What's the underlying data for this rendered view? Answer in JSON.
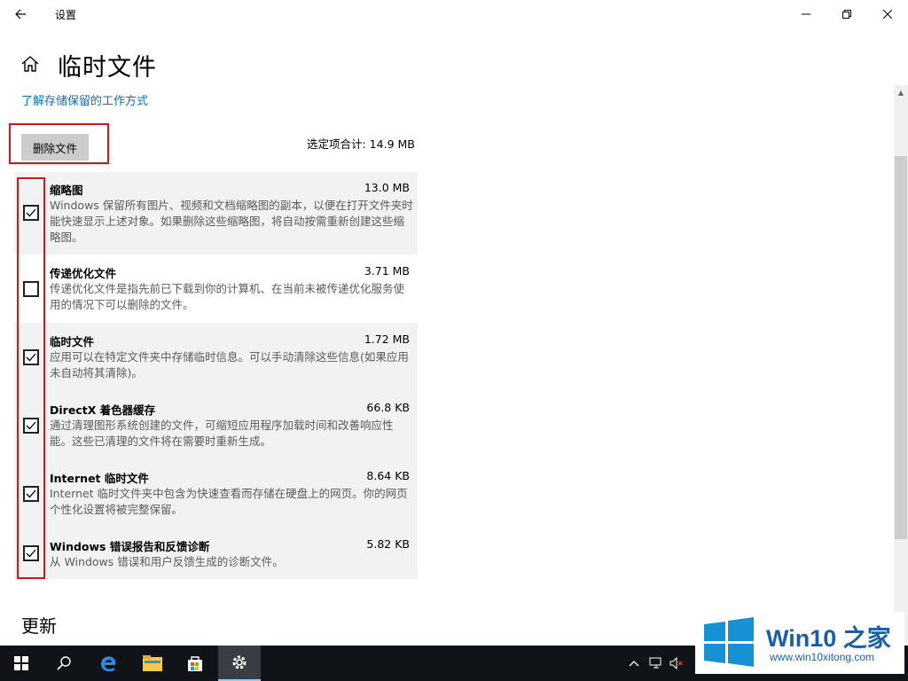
{
  "window": {
    "title": "设置",
    "back_icon": "back-arrow-icon",
    "minimize_icon": "minimize-icon",
    "maximize_icon": "restore-icon",
    "close_icon": "close-icon"
  },
  "header": {
    "home_icon": "home-icon",
    "title": "临时文件",
    "learn_link": "了解存储保留的工作方式"
  },
  "actions": {
    "delete_label": "删除文件",
    "selected_total": "选定项合计: 14.9 MB"
  },
  "items": [
    {
      "name": "缩略图",
      "size": "13.0 MB",
      "checked": true,
      "description": "Windows 保留所有图片、视频和文档缩略图的副本，以便在打开文件夹时能快速显示上述对象。如果删除这些缩略图，将自动按需重新创建这些缩略图。"
    },
    {
      "name": "传递优化文件",
      "size": "3.71 MB",
      "checked": false,
      "description": "传递优化文件是指先前已下载到你的计算机、在当前未被传递优化服务使用的情况下可以删除的文件。"
    },
    {
      "name": "临时文件",
      "size": "1.72 MB",
      "checked": true,
      "description": "应用可以在特定文件夹中存储临时信息。可以手动清除这些信息(如果应用未自动将其清除)。"
    },
    {
      "name": "DirectX 着色器缓存",
      "size": "66.8 KB",
      "checked": true,
      "description": "通过清理图形系统创建的文件，可缩短应用程序加载时间和改善响应性能。这些已清理的文件将在需要时重新生成。"
    },
    {
      "name": "Internet 临时文件",
      "size": "8.64 KB",
      "checked": true,
      "description": "Internet 临时文件夹中包含为快速查看而存储在硬盘上的网页。你的网页个性化设置将被完整保留。"
    },
    {
      "name": "Windows 错误报告和反馈诊断",
      "size": "5.82 KB",
      "checked": true,
      "description": "从 Windows 错误和用户反馈生成的诊断文件。"
    }
  ],
  "sections": {
    "update_heading": "更新"
  },
  "taskbar": {
    "icons": [
      "windows-start-icon",
      "search-icon",
      "edge-icon",
      "file-explorer-icon",
      "store-icon",
      "settings-icon"
    ],
    "tray": [
      "chevron-up-icon",
      "network-icon",
      "volume-muted-icon"
    ]
  },
  "watermark": {
    "brand": "Win10 之家",
    "url": "www.win10xitong.com"
  },
  "colors": {
    "link": "#0a6fbf",
    "annotation_red": "#d0171e",
    "taskbar": "#101418",
    "brand_blue": "#1a5ea8"
  }
}
